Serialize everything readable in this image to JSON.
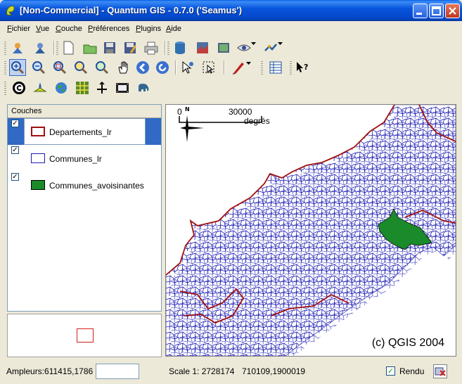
{
  "window": {
    "title": "[Non-Commercial] - Quantum GIS - 0.7.0 ('Seamus')"
  },
  "menubar": [
    "Fichier",
    "Vue",
    "Couche",
    "Préférences",
    "Plugins",
    "Aide"
  ],
  "toolbar_row1": [
    "add-layer-icon",
    "add-wms-icon",
    "new-project-icon",
    "open-project-icon",
    "save-project-icon",
    "save-as-icon",
    "print-icon",
    "add-vector-icon",
    "add-raster-icon",
    "add-postgis-icon",
    "identify-icon",
    "capture-icon"
  ],
  "toolbar_row2": [
    "zoom-in-icon",
    "zoom-out-icon",
    "zoom-full-icon",
    "zoom-selection-icon",
    "zoom-layer-icon",
    "pan-icon",
    "zoom-previous-icon",
    "refresh-icon",
    "identify-select-icon",
    "select-icon",
    "measure-icon",
    "attribute-table-icon",
    "whats-this-icon"
  ],
  "toolbar_row3": [
    "copyright-icon",
    "north-arrow-icon",
    "globe-icon",
    "grid-icon",
    "scalebar-icon",
    "film-icon",
    "elephant-icon"
  ],
  "legend": {
    "header": "Couches",
    "layers": [
      {
        "name": "Departements_lr",
        "checked": "✓",
        "symbol_color": "#a01010",
        "fill": "none"
      },
      {
        "name": "Communes_lr",
        "checked": "✓",
        "symbol_color": "#1c1cb4",
        "fill": "none"
      },
      {
        "name": "Communes_avoisinantes",
        "checked": "✓",
        "symbol_color": "#000000",
        "fill": "#1a8a2a"
      }
    ]
  },
  "map": {
    "scalebar_left": "0",
    "scalebar_right": "30000",
    "scalebar_unit": "degrés",
    "north_label": "N",
    "copyright": "(c) QGIS 2004"
  },
  "status": {
    "extents": "Ampleurs:611415,1786",
    "scale": "Scale 1: 2728174",
    "coords": "710109,1900019",
    "render_label": "Rendu",
    "render_checked": "✓"
  }
}
